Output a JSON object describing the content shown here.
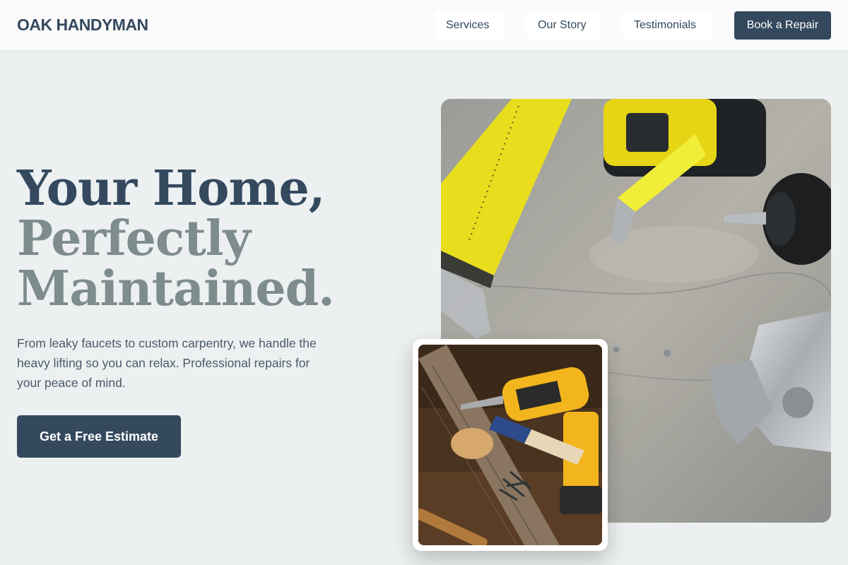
{
  "header": {
    "brand": "OAK HANDYMAN",
    "nav": {
      "services": "Services",
      "story": "Our Story",
      "testimonials": "Testimonials"
    },
    "book_label": "Book a Repair"
  },
  "hero": {
    "headline_line1": "Your Home,",
    "headline_line2": "Perfectly",
    "headline_line3": "Maintained.",
    "subtext": "From leaky faucets to custom carpentry, we handle the heavy lifting so you can relax. Professional repairs for your peace of mind.",
    "cta_label": "Get a Free Estimate"
  },
  "images": {
    "main": "tools-on-concrete-photo",
    "inset": "drill-and-wood-photo"
  },
  "colors": {
    "primary": "#34495e",
    "muted_headline": "#7f8c8d",
    "background": "#ecf0f1"
  }
}
